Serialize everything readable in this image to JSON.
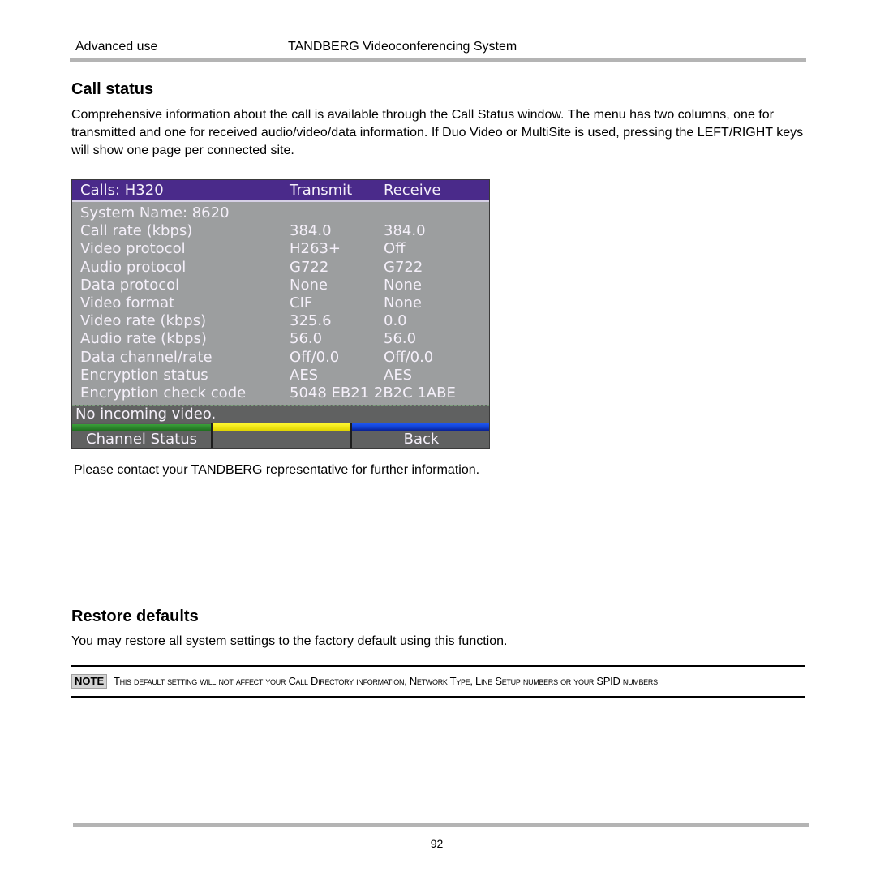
{
  "header": {
    "section": "Advanced use",
    "product": "TANDBERG Videoconferencing System"
  },
  "call_status": {
    "heading": "Call status",
    "intro": "Comprehensive information about the call is available through the Call Status window. The menu has two columns, one for transmitted and one for received audio/video/data information. If Duo Video or MultiSite is used, pressing the LEFT/RIGHT keys will show one page per connected site.",
    "screen": {
      "title": "Calls: H320",
      "col_transmit": "Transmit",
      "col_receive": "Receive",
      "colors": {
        "title_bar": "#4a2a8a",
        "body": "#9c9e9f",
        "status_bar": "#606161",
        "text": "#f5f0fa",
        "key_green": "#2e8b2e",
        "key_yellow": "#f5f000",
        "key_blue": "#1040d0"
      },
      "rows": [
        {
          "label": "System Name: 8620",
          "transmit": "",
          "receive": ""
        },
        {
          "label": "Call rate (kbps)",
          "transmit": "384.0",
          "receive": "384.0"
        },
        {
          "label": "Video protocol",
          "transmit": "H263+",
          "receive": "Off"
        },
        {
          "label": "Audio protocol",
          "transmit": "G722",
          "receive": "G722"
        },
        {
          "label": "Data protocol",
          "transmit": "None",
          "receive": "None"
        },
        {
          "label": "Video format",
          "transmit": "CIF",
          "receive": "None"
        },
        {
          "label": "Video rate (kbps)",
          "transmit": "325.6",
          "receive": "0.0"
        },
        {
          "label": "Audio rate (kbps)",
          "transmit": "56.0",
          "receive": "56.0"
        },
        {
          "label": "Data channel/rate",
          "transmit": "Off/0.0",
          "receive": "Off/0.0"
        },
        {
          "label": "Encryption status",
          "transmit": "AES",
          "receive": "AES"
        },
        {
          "label": "Encryption check code",
          "transmit": "5048 EB21 2B2C 1ABE",
          "receive": ""
        }
      ],
      "status_message": "No incoming video.",
      "softkeys": [
        {
          "label": "Channel Status",
          "color": "green"
        },
        {
          "label": "",
          "color": "yellow"
        },
        {
          "label": "Back",
          "color": "blue"
        }
      ]
    },
    "after_text": "Please contact your TANDBERG representative for further information."
  },
  "restore_defaults": {
    "heading": "Restore defaults",
    "text": "You may restore all system settings to the factory default using this function.",
    "note_label": "NOTE",
    "note_text": "This default setting will not affect your Call Directory information, Network Type, Line Setup numbers or your SPID numbers"
  },
  "footer": {
    "page_number": "92"
  }
}
